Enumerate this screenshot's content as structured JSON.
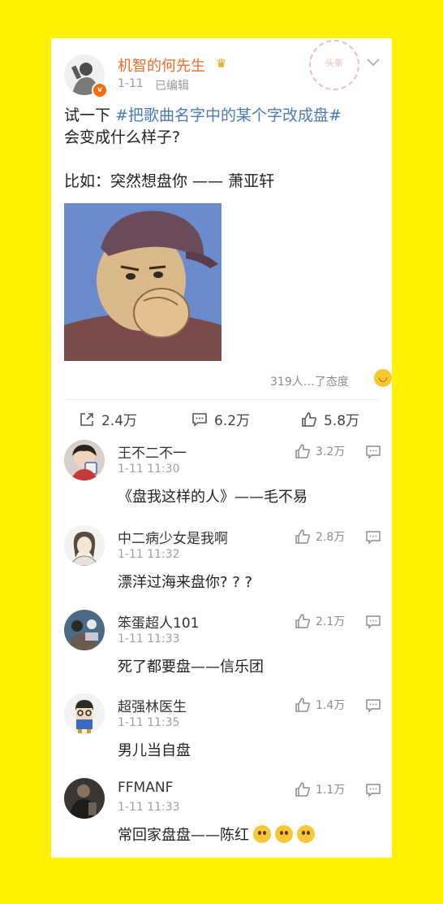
{
  "post": {
    "author": "机智的何先生",
    "verified_badge": "v",
    "time": "1-11",
    "edited": "已编辑",
    "stamp": "头条",
    "text_prefix": "试一下 ",
    "hashtag": "#把歌曲名字中的某个字改成盘#",
    "text_line2": "会变成什么样子?",
    "example": "比如：突然想盘你 —— 萧亚轩",
    "likes_summary": "319人…了态度"
  },
  "actions": {
    "share": "2.4万",
    "comment": "6.2万",
    "like": "5.8万"
  },
  "comments": [
    {
      "name": "王不二不一",
      "time": "1-11 11:30",
      "text": "《盘我这样的人》——毛不易",
      "likes": "3.2万"
    },
    {
      "name": "中二病少女是我啊",
      "time": "1-11 11:32",
      "text": "漂洋过海来盘你? ? ?",
      "likes": "2.8万"
    },
    {
      "name": "笨蛋超人101",
      "time": "1-11 11:33",
      "text": "死了都要盘——信乐团",
      "likes": "2.1万"
    },
    {
      "name": "超强林医生",
      "time": "1-11 11:35",
      "text": "男儿当自盘",
      "likes": "1.4万"
    },
    {
      "name": "FFMANF",
      "time": "1-11 11:33",
      "text": "常回家盘盘——陈红",
      "likes": "1.1万"
    }
  ],
  "icons": [
    "share-icon",
    "comment-icon",
    "thumbs-up-icon",
    "reply-icon",
    "chevron-down-icon",
    "smile-emoji-icon"
  ],
  "colors": {
    "background": "#fff200",
    "author_name": "#f26b22",
    "hashtag": "#4a7ab8"
  }
}
